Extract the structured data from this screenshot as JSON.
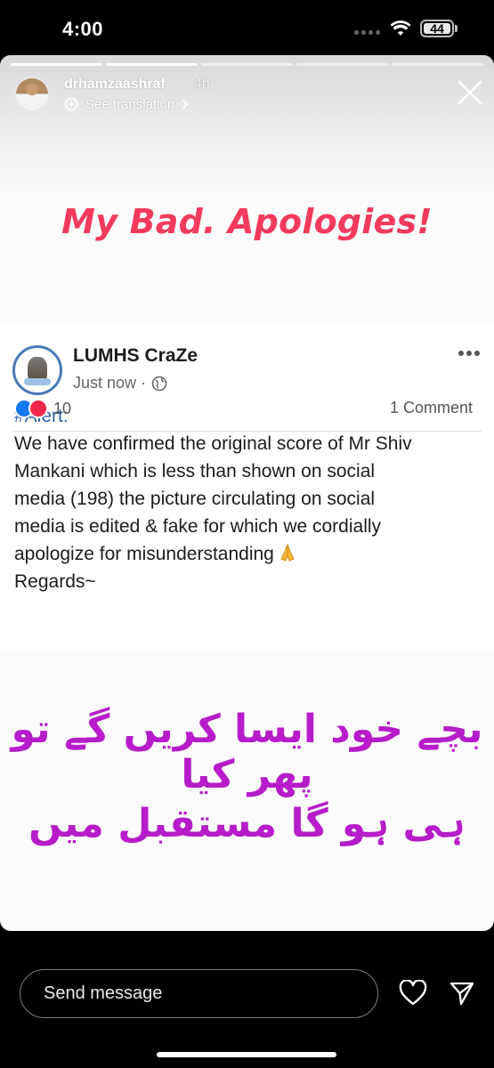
{
  "status_bar": {
    "time": "4:00",
    "battery_percent": "44"
  },
  "story": {
    "progress_segments": 5,
    "progress_done": 2,
    "username": "drhamzaashraf",
    "age": "4h",
    "translate_label": "See translation",
    "headline": "My Bad. Apologies!",
    "caption_line_1": "بچے خود ایسا کریں گے تو پھر کیا",
    "caption_line_2": "ہی ہو گا مستقبل میں",
    "caption_color": "#b61cc9",
    "headline_color": "#f23b5c"
  },
  "post": {
    "page_name": "LUMHS CraZe",
    "time": "Just now ·",
    "hashtag": "#Alert:",
    "body_lines": [
      "We have confirmed the original score of Mr Shiv",
      "Mankani which is less than shown on social",
      "media (198) the picture circulating on social",
      "media is edited & fake for which we cordially",
      "apologize for misunderstanding",
      "Regards~"
    ],
    "reaction_count": "10",
    "comments": "1 Comment",
    "icons": [
      "globe-icon",
      "more-icon",
      "like-icon",
      "love-icon",
      "pray-emoji"
    ]
  },
  "bottom_bar": {
    "message_placeholder": "Send message",
    "icons": [
      "heart-icon",
      "send-icon"
    ]
  }
}
